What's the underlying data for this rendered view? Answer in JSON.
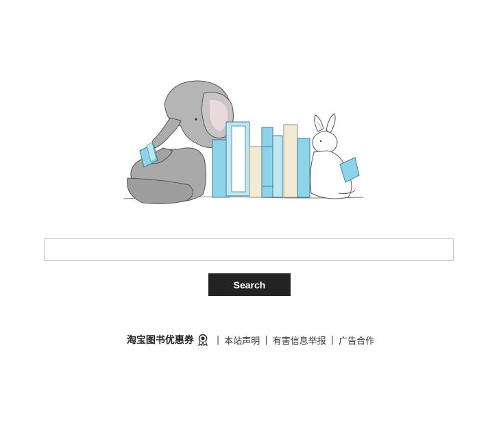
{
  "hero": {
    "illustration": "elephant-and-bunny-reading-with-books"
  },
  "search": {
    "value": "",
    "placeholder": "",
    "button_label": "Search"
  },
  "footer": {
    "brand": "淘宝图书优惠券",
    "badge_icon": "ribbon-award-icon",
    "links": [
      {
        "label": "本站声明"
      },
      {
        "label": "有害信息举报"
      },
      {
        "label": "广告合作"
      }
    ],
    "separator": "|"
  },
  "colors": {
    "button_bg": "#232323",
    "button_text": "#ffffff",
    "input_border": "#c9c9c9",
    "book_blue": "#8fd3ea",
    "book_cream": "#f2ead2"
  }
}
